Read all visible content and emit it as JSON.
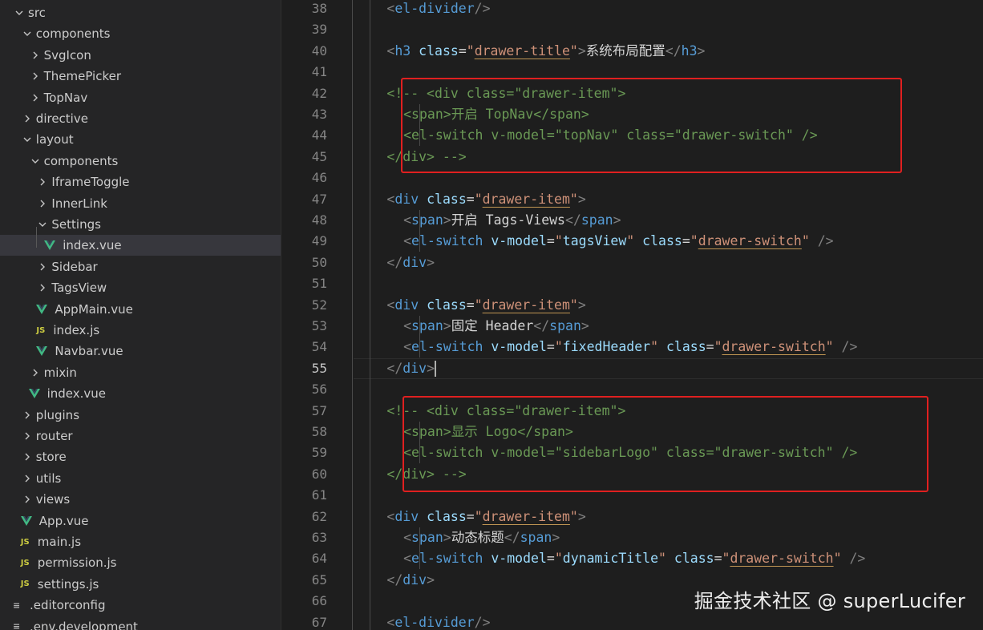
{
  "explorer": {
    "items": [
      {
        "label": "src",
        "depth": 0,
        "type": "folder",
        "open": true
      },
      {
        "label": "components",
        "depth": 1,
        "type": "folder",
        "open": true
      },
      {
        "label": "SvgIcon",
        "depth": 2,
        "type": "folder",
        "open": false
      },
      {
        "label": "ThemePicker",
        "depth": 2,
        "type": "folder",
        "open": false
      },
      {
        "label": "TopNav",
        "depth": 2,
        "type": "folder",
        "open": false
      },
      {
        "label": "directive",
        "depth": 1,
        "type": "folder",
        "open": false
      },
      {
        "label": "layout",
        "depth": 1,
        "type": "folder",
        "open": true
      },
      {
        "label": "components",
        "depth": 2,
        "type": "folder",
        "open": true
      },
      {
        "label": "IframeToggle",
        "depth": 3,
        "type": "folder",
        "open": false
      },
      {
        "label": "InnerLink",
        "depth": 3,
        "type": "folder",
        "open": false
      },
      {
        "label": "Settings",
        "depth": 3,
        "type": "folder",
        "open": true
      },
      {
        "label": "index.vue",
        "depth": 4,
        "type": "vue",
        "selected": true
      },
      {
        "label": "Sidebar",
        "depth": 3,
        "type": "folder",
        "open": false
      },
      {
        "label": "TagsView",
        "depth": 3,
        "type": "folder",
        "open": false
      },
      {
        "label": "AppMain.vue",
        "depth": 3,
        "type": "vue"
      },
      {
        "label": "index.js",
        "depth": 3,
        "type": "js"
      },
      {
        "label": "Navbar.vue",
        "depth": 3,
        "type": "vue"
      },
      {
        "label": "mixin",
        "depth": 2,
        "type": "folder",
        "open": false
      },
      {
        "label": "index.vue",
        "depth": 2,
        "type": "vue"
      },
      {
        "label": "plugins",
        "depth": 1,
        "type": "folder",
        "open": false
      },
      {
        "label": "router",
        "depth": 1,
        "type": "folder",
        "open": false
      },
      {
        "label": "store",
        "depth": 1,
        "type": "folder",
        "open": false
      },
      {
        "label": "utils",
        "depth": 1,
        "type": "folder",
        "open": false
      },
      {
        "label": "views",
        "depth": 1,
        "type": "folder",
        "open": false
      },
      {
        "label": "App.vue",
        "depth": 1,
        "type": "vue"
      },
      {
        "label": "main.js",
        "depth": 1,
        "type": "js"
      },
      {
        "label": "permission.js",
        "depth": 1,
        "type": "js"
      },
      {
        "label": "settings.js",
        "depth": 1,
        "type": "js"
      },
      {
        "label": ".editorconfig",
        "depth": 0,
        "type": "config"
      },
      {
        "label": ".env.development",
        "depth": 0,
        "type": "config"
      }
    ],
    "icons": {
      "vue": "V",
      "js": "JS",
      "config": "≡"
    },
    "colors": {
      "vue": "#41b883",
      "js": "#cbcb41",
      "config": "#b5b5b5"
    }
  },
  "editor": {
    "current_line": 55,
    "lines": [
      {
        "n": 38,
        "indent": 2,
        "tokens": [
          [
            "p",
            "<"
          ],
          [
            "tag",
            "el-divider"
          ],
          [
            "p",
            "/>"
          ]
        ]
      },
      {
        "n": 39,
        "indent": 0,
        "tokens": []
      },
      {
        "n": 40,
        "indent": 2,
        "tokens": [
          [
            "p",
            "<"
          ],
          [
            "tag",
            "h3"
          ],
          [
            "txt",
            " "
          ],
          [
            "attr",
            "class"
          ],
          [
            "txt",
            "="
          ],
          [
            "str",
            "\""
          ],
          [
            "stru",
            "drawer-title"
          ],
          [
            "str",
            "\""
          ],
          [
            "p",
            ">"
          ],
          [
            "txt",
            "系统布局配置"
          ],
          [
            "p",
            "</"
          ],
          [
            "tag",
            "h3"
          ],
          [
            "p",
            ">"
          ]
        ]
      },
      {
        "n": 41,
        "indent": 0,
        "tokens": []
      },
      {
        "n": 42,
        "indent": 2,
        "tokens": [
          [
            "com",
            "<!-- <div class=\"drawer-item\">"
          ]
        ]
      },
      {
        "n": 43,
        "indent": 3,
        "tokens": [
          [
            "com",
            "<span>开启 TopNav</span>"
          ]
        ]
      },
      {
        "n": 44,
        "indent": 3,
        "tokens": [
          [
            "com",
            "<el-switch v-model=\"topNav\" class=\"drawer-switch\" />"
          ]
        ]
      },
      {
        "n": 45,
        "indent": 2,
        "tokens": [
          [
            "com",
            "</div> -->"
          ]
        ]
      },
      {
        "n": 46,
        "indent": 0,
        "tokens": []
      },
      {
        "n": 47,
        "indent": 2,
        "tokens": [
          [
            "p",
            "<"
          ],
          [
            "tag",
            "div"
          ],
          [
            "txt",
            " "
          ],
          [
            "attr",
            "class"
          ],
          [
            "txt",
            "="
          ],
          [
            "str",
            "\""
          ],
          [
            "stru",
            "drawer-item"
          ],
          [
            "str",
            "\""
          ],
          [
            "p",
            ">"
          ]
        ]
      },
      {
        "n": 48,
        "indent": 3,
        "tokens": [
          [
            "p",
            "<"
          ],
          [
            "tag",
            "span"
          ],
          [
            "p",
            ">"
          ],
          [
            "txt",
            "开启 Tags-Views"
          ],
          [
            "p",
            "</"
          ],
          [
            "tag",
            "span"
          ],
          [
            "p",
            ">"
          ]
        ]
      },
      {
        "n": 49,
        "indent": 3,
        "tokens": [
          [
            "p",
            "<"
          ],
          [
            "tag",
            "el-switch"
          ],
          [
            "txt",
            " "
          ],
          [
            "attr",
            "v-model"
          ],
          [
            "txt",
            "="
          ],
          [
            "str",
            "\""
          ],
          [
            "attr",
            "tagsView"
          ],
          [
            "str",
            "\""
          ],
          [
            "txt",
            " "
          ],
          [
            "attr",
            "class"
          ],
          [
            "txt",
            "="
          ],
          [
            "str",
            "\""
          ],
          [
            "stru",
            "drawer-switch"
          ],
          [
            "str",
            "\""
          ],
          [
            "txt",
            " "
          ],
          [
            "p",
            "/>"
          ]
        ]
      },
      {
        "n": 50,
        "indent": 2,
        "tokens": [
          [
            "p",
            "</"
          ],
          [
            "tag",
            "div"
          ],
          [
            "p",
            ">"
          ]
        ]
      },
      {
        "n": 51,
        "indent": 0,
        "tokens": []
      },
      {
        "n": 52,
        "indent": 2,
        "tokens": [
          [
            "p",
            "<"
          ],
          [
            "tag",
            "div"
          ],
          [
            "txt",
            " "
          ],
          [
            "attr",
            "class"
          ],
          [
            "txt",
            "="
          ],
          [
            "str",
            "\""
          ],
          [
            "stru",
            "drawer-item"
          ],
          [
            "str",
            "\""
          ],
          [
            "p",
            ">"
          ]
        ]
      },
      {
        "n": 53,
        "indent": 3,
        "tokens": [
          [
            "p",
            "<"
          ],
          [
            "tag",
            "span"
          ],
          [
            "p",
            ">"
          ],
          [
            "txt",
            "固定 Header"
          ],
          [
            "p",
            "</"
          ],
          [
            "tag",
            "span"
          ],
          [
            "p",
            ">"
          ]
        ]
      },
      {
        "n": 54,
        "indent": 3,
        "tokens": [
          [
            "p",
            "<"
          ],
          [
            "tag",
            "el-switch"
          ],
          [
            "txt",
            " "
          ],
          [
            "attr",
            "v-model"
          ],
          [
            "txt",
            "="
          ],
          [
            "str",
            "\""
          ],
          [
            "attr",
            "fixedHeader"
          ],
          [
            "str",
            "\""
          ],
          [
            "txt",
            " "
          ],
          [
            "attr",
            "class"
          ],
          [
            "txt",
            "="
          ],
          [
            "str",
            "\""
          ],
          [
            "stru",
            "drawer-switch"
          ],
          [
            "str",
            "\""
          ],
          [
            "txt",
            " "
          ],
          [
            "p",
            "/>"
          ]
        ]
      },
      {
        "n": 55,
        "indent": 2,
        "tokens": [
          [
            "p",
            "</"
          ],
          [
            "tag",
            "div"
          ],
          [
            "p",
            ">"
          ]
        ],
        "cursor": true
      },
      {
        "n": 56,
        "indent": 0,
        "tokens": []
      },
      {
        "n": 57,
        "indent": 2,
        "tokens": [
          [
            "com",
            "<!-- <div class=\"drawer-item\">"
          ]
        ]
      },
      {
        "n": 58,
        "indent": 3,
        "tokens": [
          [
            "com",
            "<span>显示 Logo</span>"
          ]
        ]
      },
      {
        "n": 59,
        "indent": 3,
        "tokens": [
          [
            "com",
            "<el-switch v-model=\"sidebarLogo\" class=\"drawer-switch\" />"
          ]
        ]
      },
      {
        "n": 60,
        "indent": 2,
        "tokens": [
          [
            "com",
            "</div> -->"
          ]
        ]
      },
      {
        "n": 61,
        "indent": 0,
        "tokens": []
      },
      {
        "n": 62,
        "indent": 2,
        "tokens": [
          [
            "p",
            "<"
          ],
          [
            "tag",
            "div"
          ],
          [
            "txt",
            " "
          ],
          [
            "attr",
            "class"
          ],
          [
            "txt",
            "="
          ],
          [
            "str",
            "\""
          ],
          [
            "stru",
            "drawer-item"
          ],
          [
            "str",
            "\""
          ],
          [
            "p",
            ">"
          ]
        ]
      },
      {
        "n": 63,
        "indent": 3,
        "tokens": [
          [
            "p",
            "<"
          ],
          [
            "tag",
            "span"
          ],
          [
            "p",
            ">"
          ],
          [
            "txt",
            "动态标题"
          ],
          [
            "p",
            "</"
          ],
          [
            "tag",
            "span"
          ],
          [
            "p",
            ">"
          ]
        ]
      },
      {
        "n": 64,
        "indent": 3,
        "tokens": [
          [
            "p",
            "<"
          ],
          [
            "tag",
            "el-switch"
          ],
          [
            "txt",
            " "
          ],
          [
            "attr",
            "v-model"
          ],
          [
            "txt",
            "="
          ],
          [
            "str",
            "\""
          ],
          [
            "attr",
            "dynamicTitle"
          ],
          [
            "str",
            "\""
          ],
          [
            "txt",
            " "
          ],
          [
            "attr",
            "class"
          ],
          [
            "txt",
            "="
          ],
          [
            "str",
            "\""
          ],
          [
            "stru",
            "drawer-switch"
          ],
          [
            "str",
            "\""
          ],
          [
            "txt",
            " "
          ],
          [
            "p",
            "/>"
          ]
        ]
      },
      {
        "n": 65,
        "indent": 2,
        "tokens": [
          [
            "p",
            "</"
          ],
          [
            "tag",
            "div"
          ],
          [
            "p",
            ">"
          ]
        ]
      },
      {
        "n": 66,
        "indent": 0,
        "tokens": []
      },
      {
        "n": 67,
        "indent": 2,
        "tokens": [
          [
            "p",
            "<"
          ],
          [
            "tag",
            "el-divider"
          ],
          [
            "p",
            "/>"
          ]
        ]
      }
    ]
  },
  "watermark": {
    "text": "掘金技术社区 @ superLucifer"
  },
  "colors": {
    "background": "#1e1e1e",
    "sidebar": "#252526",
    "highlight_box": "#e02020",
    "comment": "#6a9955",
    "tag": "#569cd6",
    "attribute": "#9cdcfe",
    "string": "#ce9178"
  }
}
